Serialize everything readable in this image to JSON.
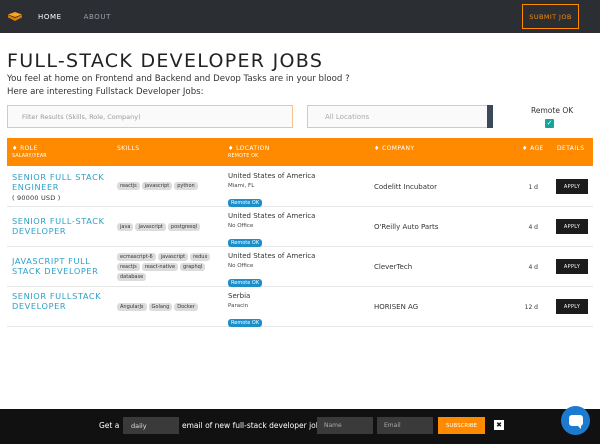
{
  "nav": {
    "home": "HOME",
    "about": "ABOUT",
    "submit_job": "SUBMIT JOB"
  },
  "page": {
    "title": "FULL-STACK DEVELOPER JOBS",
    "intro_line1": "You feel at home on Frontend and Backend and Devop Tasks are in your blood ?",
    "intro_line2": "Here are interesting Fullstack Developer Jobs:"
  },
  "filters": {
    "search_placeholder": "Filter Results (Skills, Role, Company)",
    "location_placeholder": "All Locations",
    "remote_label": "Remote OK",
    "remote_checked": true
  },
  "table": {
    "headers": {
      "role": "♦ ROLE",
      "role_sub": "SALARY/YEAR",
      "skills": "SKILLS",
      "location": "♦ LOCATION",
      "location_sub": "REMOTE OK",
      "company": "♦ COMPANY",
      "age": "♦ AGE",
      "details": "DETAILS"
    },
    "rows": [
      {
        "role": "SENIOR FULL STACK ENGINEER",
        "salary": "( 90000 USD )",
        "skills": [
          "reactjs",
          "javascript",
          "python"
        ],
        "country": "United States of America",
        "city": "Miami, FL",
        "remote": "Remote OK",
        "company": "Codelitt Incubator",
        "age": "1 d",
        "apply": "APPLY"
      },
      {
        "role": "SENIOR FULL-STACK DEVELOPER",
        "salary": "",
        "skills": [
          "java",
          "javascript",
          "postgresql"
        ],
        "country": "United States of America",
        "city": "No Office",
        "remote": "Remote OK",
        "company": "O'Reilly Auto Parts",
        "age": "4 d",
        "apply": "APPLY"
      },
      {
        "role": "JAVASCRIPT FULL STACK DEVELOPER",
        "salary": "",
        "skills": [
          "ecmascript-6",
          "javascript",
          "redux",
          "reactjs",
          "react-native",
          "graphql",
          "database"
        ],
        "country": "United States of America",
        "city": "No Office",
        "remote": "Remote OK",
        "company": "CleverTech",
        "age": "4 d",
        "apply": "APPLY"
      },
      {
        "role": "SENIOR FULLSTACK DEVELOPER",
        "salary": "",
        "skills": [
          "AngularJs",
          "Golang",
          "Docker"
        ],
        "country": "Serbia",
        "city": "Paracin",
        "remote": "Remote OK",
        "company": "HORISEN AG",
        "age": "12 d",
        "apply": "APPLY"
      }
    ]
  },
  "footer": {
    "get_a": "Get a",
    "frequency": "daily",
    "text": "email of new full-stack developer jobs",
    "name_placeholder": "Name",
    "email_placeholder": "Email",
    "subscribe": "SUBSCRIBE",
    "close": "✖"
  },
  "colors": {
    "accent": "#ff8a00",
    "link": "#2aa0c8",
    "nav_bg": "#2b2e33",
    "remote_badge": "#1a8fc9"
  }
}
